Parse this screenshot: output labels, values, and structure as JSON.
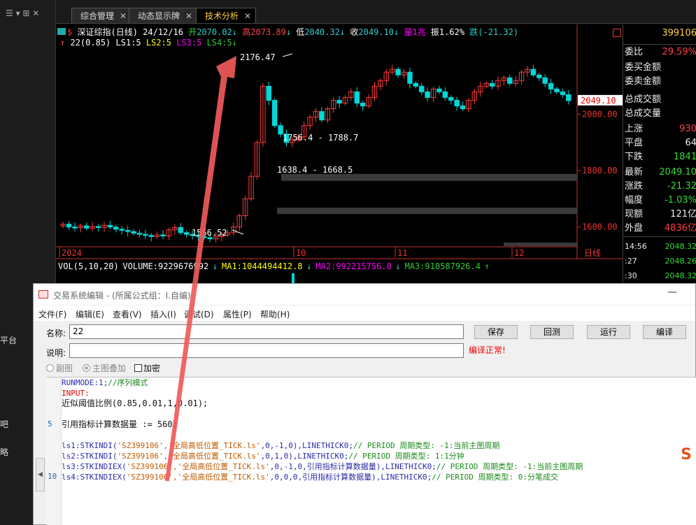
{
  "left_strip": {
    "items": [
      "平台",
      "吧",
      "略"
    ]
  },
  "tabs": [
    {
      "label": "综合管理",
      "close": "✕"
    },
    {
      "label": "动态显示牌",
      "close": "✕"
    },
    {
      "label": "技术分析",
      "close": "✕"
    }
  ],
  "chart_header": {
    "name": "深证综指(日线)",
    "date": "24/12/16",
    "open_label": "开",
    "open": "2070.02",
    "high_label": "高",
    "high": "2073.89",
    "low_label": "低",
    "low": "2040.32",
    "close_label": "收",
    "close": "2049.10",
    "volume": "量1兆",
    "amplitude_label": "振",
    "amplitude": "1.62%",
    "change": "跌(-21.32)",
    "line2": {
      "formula": "22(0.85)",
      "ls1": "LS1:5",
      "ls2": "LS2:5",
      "ls3": "LS3:5",
      "ls4": "LS4:5"
    }
  },
  "chart_data": {
    "type": "candlestick",
    "y_ticks": [
      "2000.00",
      "1800.00",
      "1600.00"
    ],
    "x_ticks": [
      "2024",
      "10",
      "11",
      "12"
    ],
    "x_end_label": "日线",
    "last_price_tag": "2049.10",
    "annotations": {
      "high": "2176.47",
      "low": "1556.52",
      "zone_upper": "1756.4 - 1788.7",
      "zone_lower": "1638.4 - 1668.5"
    },
    "volume_line": {
      "label": "VOL(5,10,20)",
      "volume": "VOLUME:9229676992",
      "ma1": "MA1:1044494412.8",
      "ma2": "MA2:992215756.8",
      "ma3": "MA3:910587926.4"
    },
    "colors": {
      "up": "#ff3b3b",
      "down": "#00d8d8",
      "zone": "#3a3a3a",
      "arrow": "#f05a5a"
    }
  },
  "right_panel": {
    "code": "399106",
    "rows": [
      {
        "k": "委比",
        "v": "29.59%",
        "color": "#ff4040"
      },
      {
        "k": "委买金额",
        "v": ""
      },
      {
        "k": "委卖金额",
        "v": ""
      },
      {
        "k": "总成交额",
        "v": ""
      },
      {
        "k": "总成交量",
        "v": ""
      },
      {
        "k": "上涨",
        "v": "930",
        "color": "#ff4040"
      },
      {
        "k": "平盘",
        "v": "64",
        "color": "#eeeeee"
      },
      {
        "k": "下跌",
        "v": "1841",
        "color": "#33dd33"
      },
      {
        "k": "最新",
        "v": "2049.10",
        "color": "#33dd33"
      },
      {
        "k": "涨跌",
        "v": "-21.32",
        "color": "#33dd33"
      },
      {
        "k": "幅度",
        "v": "-1.03%",
        "color": "#33dd33"
      },
      {
        "k": "现额",
        "v": "121亿",
        "color": "#eeeeee"
      },
      {
        "k": "外盘",
        "v": "4836亿",
        "color": "#ff4040"
      }
    ],
    "ticks": [
      {
        "t": "14:56",
        "v": "2048.32"
      },
      {
        "t": ":27",
        "v": "2048.26"
      },
      {
        "t": ":30",
        "v": "2048.32"
      }
    ]
  },
  "dialog": {
    "title": "交易系统编辑 - (所属公式组：I.自编)",
    "min": "—",
    "menu": [
      "文件(F)",
      "编辑(E)",
      "查看(V)",
      "插入(I)",
      "调试(D)",
      "属性(P)",
      "帮助(H)"
    ],
    "name_label": "名称:",
    "name_value": "22",
    "desc_label": "说明:",
    "desc_value": "",
    "status": "编译正常!",
    "buttons": {
      "save": "保存",
      "cancel": "回测",
      "run": "运行",
      "compile": "编译"
    },
    "radio1": "副图",
    "radio2": "主图叠加",
    "checkbox": "加密",
    "gutter_numbers": [
      "5",
      "10"
    ],
    "code": {
      "l1": "RUNMODE:1;",
      "l1c": "//序列模式",
      "l2": "INPUT:",
      "l3": "近似阈值比例(0.85,0.01,1,0.01);",
      "l5": "引用指标计算数据量  := 560;",
      "l7a": "ls1:STKINDI(",
      "l7s": "'SZ399106','全局高低位置_TICK.ls'",
      "l7b": ",0,-1,0),LINETHICK0;",
      "l7c": "//  PERIOD 周期类型: -1:当前主图周期",
      "l8a": "ls2:STKINDI(",
      "l8s": "'SZ399106','全局高低位置_TICK.ls'",
      "l8b": ",0,1,0),LINETHICK0;",
      "l8c": "//  PERIOD 周期类型: 1:1分钟",
      "l9a": "ls3:STKINDIEX(",
      "l9s": "'SZ399106','全局高低位置_TICK.ls'",
      "l9b": ",0,-1,0,引用指标计算数据量),LINETHICK0;",
      "l9c": "//  PERIOD 周期类型: -1:当前主图周期",
      "l10a": "ls4:STKINDIEX(",
      "l10s": "'SZ399106','全局高低位置_TICK.ls'",
      "l10b": ",0,0,0,引用指标计算数据量),LINETHICK0;",
      "l10c": "//  PERIOD 周期类型: 0:分笔成交"
    }
  }
}
